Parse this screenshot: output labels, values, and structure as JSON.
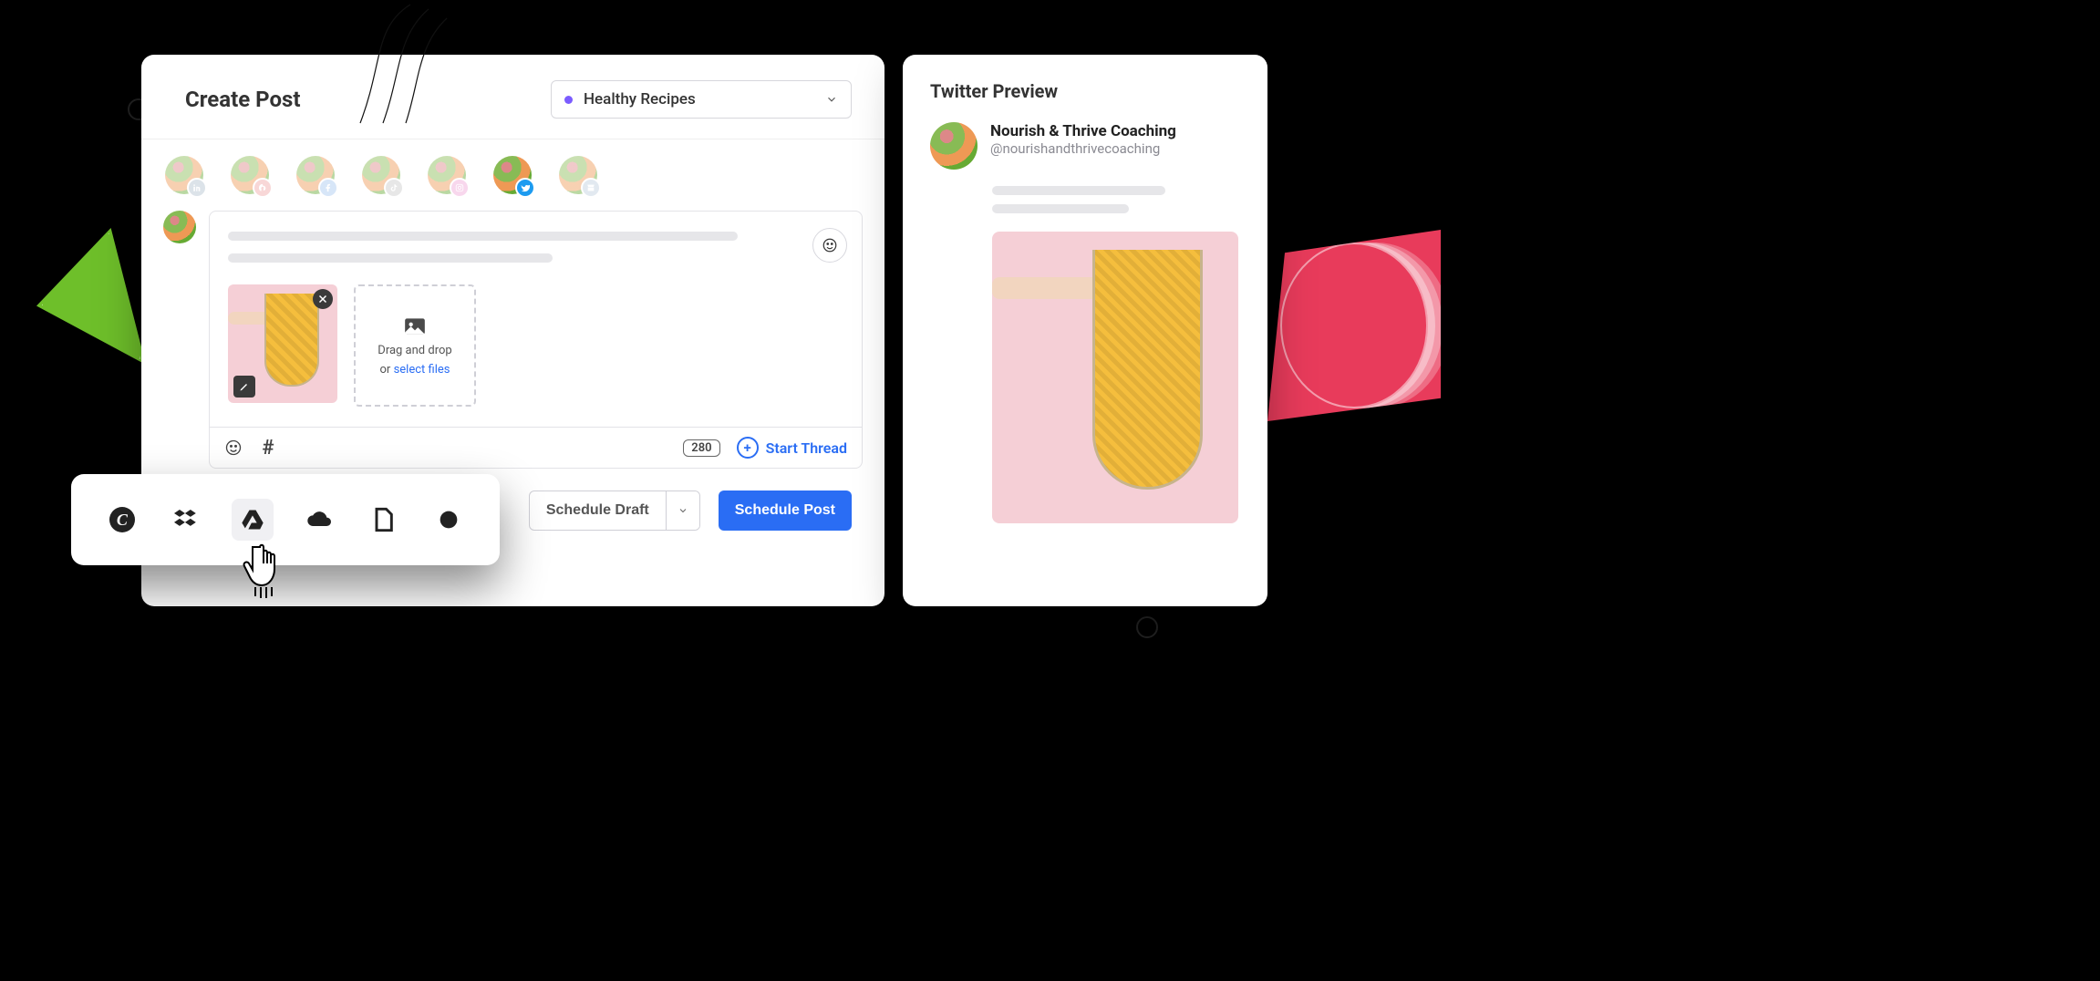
{
  "composer": {
    "title": "Create Post",
    "dropdown": {
      "selected": "Healthy Recipes"
    },
    "accounts": [
      {
        "network": "linkedin",
        "active": false
      },
      {
        "network": "pinterest",
        "active": false
      },
      {
        "network": "facebook",
        "active": false
      },
      {
        "network": "tiktok",
        "active": false
      },
      {
        "network": "instagram",
        "active": false
      },
      {
        "network": "twitter",
        "active": true
      },
      {
        "network": "googlebusiness",
        "active": false
      }
    ],
    "dropzone": {
      "line1": "Drag and drop",
      "line2_prefix": "or ",
      "link": "select files"
    },
    "char_limit": "280",
    "start_thread": "Start Thread",
    "actions": {
      "draft": "Schedule Draft",
      "primary": "Schedule Post"
    }
  },
  "upload_sources": {
    "items": [
      "canva",
      "dropbox",
      "google-drive",
      "cloud",
      "file",
      "google-photos"
    ],
    "hovered": "google-drive"
  },
  "preview": {
    "title": "Twitter Preview",
    "account_name": "Nourish & Thrive Coaching",
    "account_handle": "@nourishandthrivecoaching"
  },
  "colors": {
    "primary": "#2a6df4",
    "dropdown_dot": "#7b5cff",
    "twitter": "#1d9bf0"
  }
}
